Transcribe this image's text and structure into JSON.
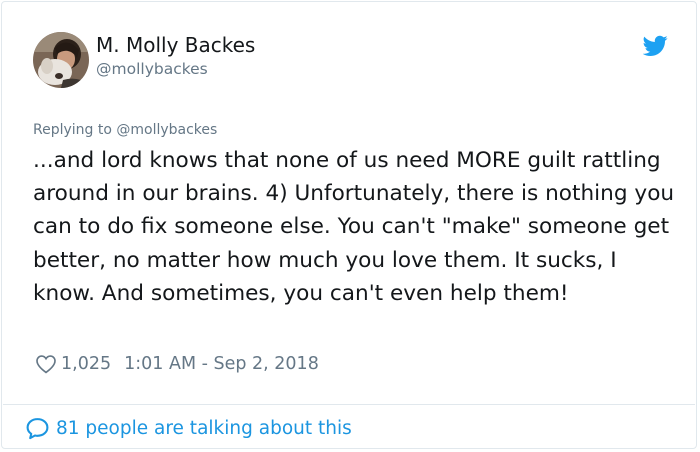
{
  "author": {
    "display_name": "M. Molly Backes",
    "handle": "@mollybackes"
  },
  "reply": {
    "text": "Replying to @mollybackes"
  },
  "tweet": {
    "text": "...and lord knows that none of us need MORE guilt rattling around in our brains. 4) Unfortunately, there is nothing you can to do fix someone else. You can't \"make\" someone get better, no matter how much you love them. It sucks, I know. And sometimes, you can't even help them!"
  },
  "stats": {
    "likes": "1,025",
    "timestamp": "1:01 AM - Sep 2, 2018"
  },
  "footer": {
    "talking_text": "81 people are talking about this"
  },
  "icons": {
    "logo": "twitter-bird-icon",
    "like": "heart-icon",
    "conversation": "speech-bubble-icon"
  },
  "colors": {
    "brand_blue": "#1da1f2",
    "link_blue": "#1b95e0",
    "muted_gray": "#657786",
    "text": "#14171a",
    "border": "#e1e8ed"
  }
}
